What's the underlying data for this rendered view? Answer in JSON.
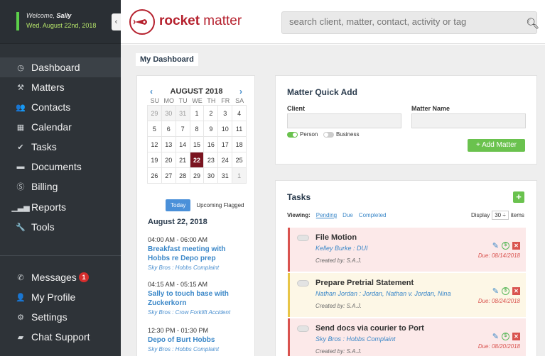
{
  "sidebar": {
    "welcome_prefix": "Welcome, ",
    "welcome_name": "Sally",
    "date": "Wed. August 22nd, 2018",
    "collapse_icon": "chevron-left-icon",
    "nav": [
      {
        "label": "Dashboard",
        "icon": "dashboard-icon"
      },
      {
        "label": "Matters",
        "icon": "gavel-icon"
      },
      {
        "label": "Contacts",
        "icon": "users-icon"
      },
      {
        "label": "Calendar",
        "icon": "calendar-icon"
      },
      {
        "label": "Tasks",
        "icon": "check-icon"
      },
      {
        "label": "Documents",
        "icon": "folder-icon"
      },
      {
        "label": "Billing",
        "icon": "dollar-icon"
      },
      {
        "label": "Reports",
        "icon": "bar-chart-icon"
      },
      {
        "label": "Tools",
        "icon": "wrench-icon"
      }
    ],
    "bottom_nav": [
      {
        "label": "Messages",
        "icon": "phone-icon",
        "badge": "1"
      },
      {
        "label": "My Profile",
        "icon": "user-icon"
      },
      {
        "label": "Settings",
        "icon": "gear-icon"
      },
      {
        "label": "Chat Support",
        "icon": "chat-icon"
      }
    ]
  },
  "header": {
    "logo_word1": "rocket",
    "logo_word2": " matter",
    "search_placeholder": "search client, matter, contact, activity or tag"
  },
  "main": {
    "tab": "My Dashboard",
    "calendar": {
      "month": "AUGUST 2018",
      "prev": "‹",
      "next": "›",
      "days_of_week": [
        "SU",
        "MO",
        "TU",
        "WE",
        "TH",
        "FR",
        "SA"
      ],
      "weeks": [
        [
          "29",
          "30",
          "31",
          "1",
          "2",
          "3",
          "4"
        ],
        [
          "5",
          "6",
          "7",
          "8",
          "9",
          "10",
          "11"
        ],
        [
          "12",
          "13",
          "14",
          "15",
          "16",
          "17",
          "18"
        ],
        [
          "19",
          "20",
          "21",
          "22",
          "23",
          "24",
          "25"
        ],
        [
          "26",
          "27",
          "28",
          "29",
          "30",
          "31",
          "1"
        ]
      ],
      "today": "Today",
      "upcoming": "Upcoming Flagged",
      "agenda_date": "August 22, 2018",
      "events": [
        {
          "time": "04:00 AM - 06:00 AM",
          "title": "Breakfast meeting with Hobbs re Depo prep",
          "matter": "Sky Bros : Hobbs Complaint"
        },
        {
          "time": "04:15 AM - 05:15 AM",
          "title": "Sally to touch base with Zuckerkorn",
          "matter": "Sky Bros : Crow Forklift Accident"
        },
        {
          "time": "12:30 PM - 01:30 PM",
          "title": "Depo of Burt Hobbs",
          "matter": "Sky Bros : Hobbs Complaint"
        }
      ]
    },
    "quick_add": {
      "title": "Matter Quick Add",
      "client_label": "Client",
      "matter_label": "Matter Name",
      "person": "Person",
      "business": "Business",
      "button": "+ Add Matter"
    },
    "tasks": {
      "title": "Tasks",
      "add": "+",
      "viewing": "Viewing:",
      "pending": "Pending",
      "due": "Due",
      "completed": "Completed",
      "display": "Display",
      "count": "30 ÷",
      "items": "items",
      "list": [
        {
          "title": "File Motion",
          "matter": "Kelley Burke : DUI",
          "created": "Created by: S.A.J.",
          "due": "Due: 08/14/2018"
        },
        {
          "title": "Prepare Pretrial Statement",
          "matter": "Nathan Jordan : Jordan, Nathan v. Jordan, Nina",
          "created": "Created by: S.A.J.",
          "due": "Due: 08/24/2018"
        },
        {
          "title": "Send docs via courier to Port",
          "matter": "Sky Bros : Hobbs Complaint",
          "created": "Created by: S.A.J.",
          "due": "Due: 08/20/2018"
        }
      ]
    }
  }
}
